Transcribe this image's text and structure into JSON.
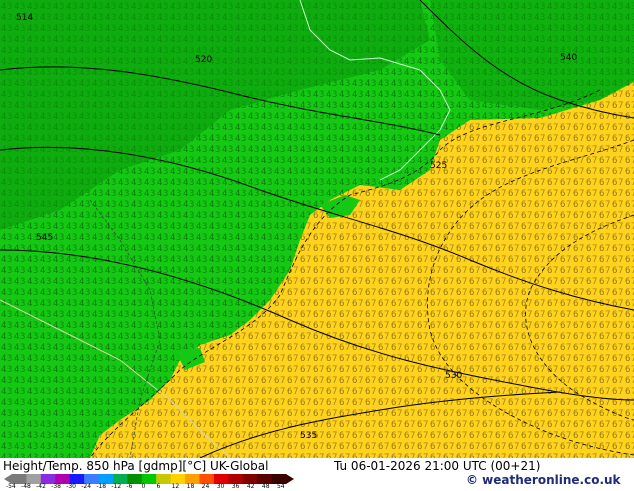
{
  "footer": {
    "title": "Height/Temp. 850 hPa [gdmp][°C] UK-Global",
    "datetime": "Tu 06-01-2026 21:00 UTC (00+21)",
    "credit": "© weatheronline.co.uk"
  },
  "legend": {
    "labels": [
      "-54",
      "-48",
      "-42",
      "-38",
      "-30",
      "-24",
      "-18",
      "-12",
      "-6",
      "0",
      "6",
      "12",
      "18",
      "24",
      "30",
      "36",
      "42",
      "48",
      "54"
    ],
    "colors": [
      "#7a7a7a",
      "#a0a0a0",
      "#8a2be2",
      "#b000b0",
      "#1a1aff",
      "#3c7dff",
      "#00a0ff",
      "#00b050",
      "#009000",
      "#00c800",
      "#c8c800",
      "#ffd200",
      "#ffa000",
      "#ff5000",
      "#e00000",
      "#b00000",
      "#800000",
      "#5a0000",
      "#3a0000"
    ]
  },
  "map": {
    "fill_colors": {
      "deep_green": "#0a9a0a",
      "green": "#14c814",
      "bright_green": "#1ed21e",
      "yellow": "#ffd21e",
      "light_yellow": "#ffe650",
      "coast_line": "#c8ffc8"
    },
    "contour_labels": [
      "514",
      "520",
      "525",
      "530",
      "535",
      "540",
      "545"
    ]
  }
}
